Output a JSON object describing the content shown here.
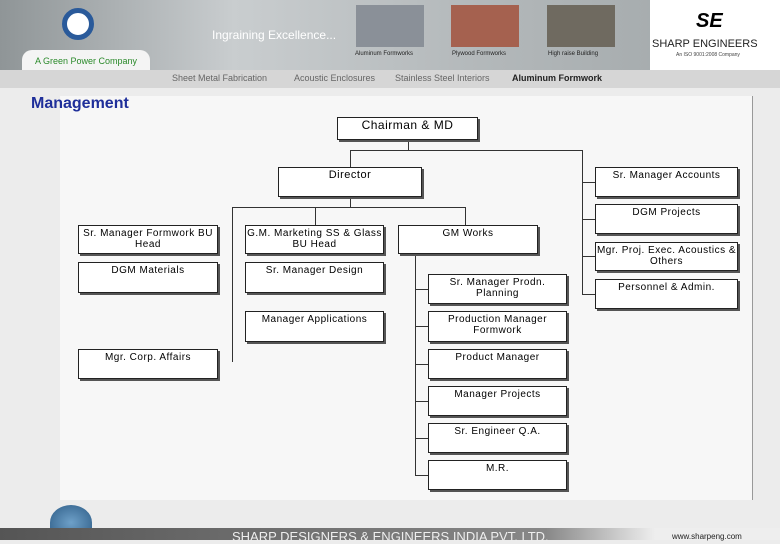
{
  "header": {
    "tagline": "Ingraining Excellence...",
    "green": "A Green Power Company",
    "captions": [
      "Aluminum Formworks",
      "Plywood Formworks",
      "High raise Building"
    ],
    "brand_mark": "SE",
    "brand": "SHARP ENGINEERS",
    "iso": "An ISO 9001:2008 Company"
  },
  "nav": [
    "Sheet Metal Fabrication",
    "Acoustic Enclosures",
    "Stainless Steel Interiors",
    "Aluminum Formwork"
  ],
  "page_title": "Management",
  "org": {
    "chairman": "Chairman & MD",
    "director": "Director",
    "col1": [
      "Sr. Manager Formwork BU Head",
      "DGM Materials",
      "Mgr. Corp. Affairs"
    ],
    "col2": [
      "G.M. Marketing SS & Glass BU Head",
      "Sr. Manager Design",
      "Manager Applications"
    ],
    "gm_works": "GM Works",
    "col3": [
      "Sr. Manager Prodn. Planning",
      "Production Manager Formwork",
      "Product Manager",
      "Manager Projects",
      "Sr. Engineer Q.A.",
      "M.R."
    ],
    "right": [
      "Sr. Manager Accounts",
      "DGM Projects",
      "Mgr. Proj. Exec. Acoustics & Others",
      "Personnel & Admin."
    ]
  },
  "footer": {
    "company": "SHARP DESIGNERS & ENGINEERS INDIA PVT. LTD.",
    "url": "www.sharpeng.com"
  }
}
